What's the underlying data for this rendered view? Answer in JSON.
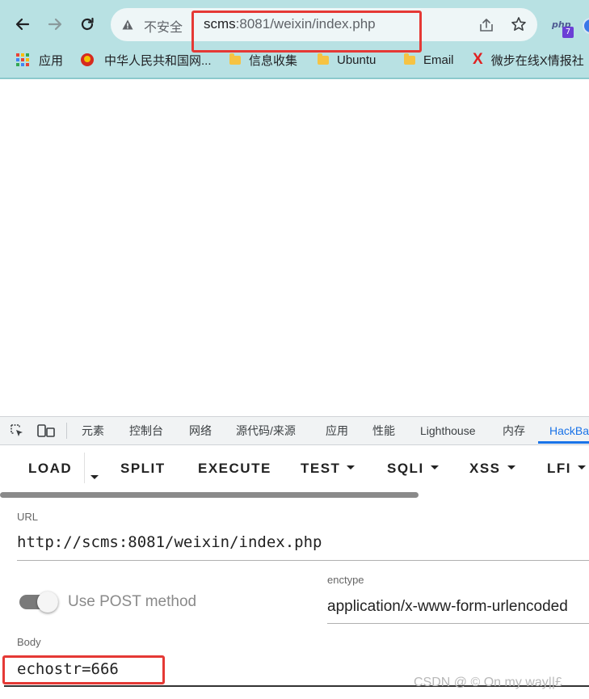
{
  "browser": {
    "security_label": "不安全",
    "url_host": "scms",
    "url_rest": ":8081/weixin/index.php",
    "extension_badge": "7",
    "extension_text": "php"
  },
  "bookmarks": [
    {
      "label": "应用",
      "icon": "apps-grid-icon"
    },
    {
      "label": "中华人民共和国网...",
      "icon": "emblem-icon"
    },
    {
      "label": "信息收集",
      "icon": "folder-icon"
    },
    {
      "label": "Ubuntu",
      "icon": "folder-icon"
    },
    {
      "label": "Email",
      "icon": "folder-icon"
    },
    {
      "label": "微步在线X情报社",
      "icon": "x-logo-icon"
    }
  ],
  "devtools": {
    "tabs": [
      "元素",
      "控制台",
      "网络",
      "源代码/来源",
      "应用",
      "性能",
      "Lighthouse",
      "内存",
      "HackBa"
    ]
  },
  "hackbar": {
    "buttons": [
      {
        "label": "LOAD",
        "dropdown": false
      },
      {
        "label": "SPLIT",
        "dropdown": false
      },
      {
        "label": "EXECUTE",
        "dropdown": false
      },
      {
        "label": "TEST",
        "dropdown": true
      },
      {
        "label": "SQLI",
        "dropdown": true
      },
      {
        "label": "XSS",
        "dropdown": true
      },
      {
        "label": "LFI",
        "dropdown": true
      }
    ],
    "url_label": "URL",
    "url_value": "http://scms:8081/weixin/index.php",
    "post_toggle_label": "Use POST method",
    "post_enabled": false,
    "enctype_label": "enctype",
    "enctype_value": "application/x-www-form-urlencoded",
    "body_label": "Body",
    "body_value": "echostr=666"
  },
  "watermark": "CSDN @ © On my way||£"
}
